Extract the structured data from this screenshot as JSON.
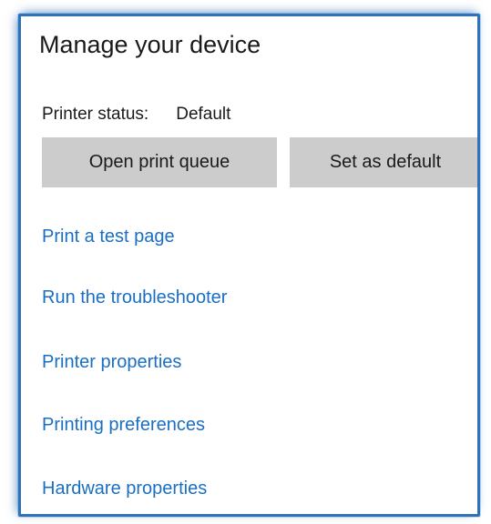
{
  "title": "Manage your device",
  "status": {
    "label": "Printer status:",
    "value": "Default"
  },
  "buttons": {
    "open_queue": "Open print queue",
    "set_default": "Set as default"
  },
  "links": [
    "Print a test page",
    "Run the troubleshooter",
    "Printer properties",
    "Printing preferences",
    "Hardware properties"
  ],
  "colors": {
    "link": "#1a6fc4",
    "button_bg": "#cccccc",
    "frame_border": "#2e72b9"
  }
}
